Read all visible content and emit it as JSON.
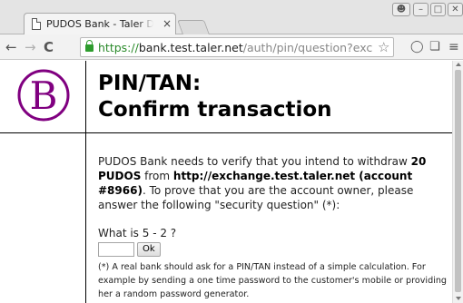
{
  "browser": {
    "tab_title": "PUDOS Bank - Taler Demo",
    "tab_close": "×",
    "url_scheme": "https://",
    "url_host": "bank.test.taler.net",
    "url_path": "/auth/pin/question?exchange_url=https://exchange.test.taler.net/",
    "icons": {
      "back": "back-arrow-icon",
      "forward": "forward-arrow-icon",
      "reload": "reload-icon",
      "lock": "lock-icon",
      "star": "star-icon",
      "menu": "hamburger-menu-icon"
    }
  },
  "page": {
    "heading_line1": "PIN/TAN:",
    "heading_line2": "Confirm transaction",
    "logo_letter": "B",
    "logo_color": "#800080",
    "intro": {
      "part1": "PUDOS Bank needs to verify that you intend to withdraw ",
      "amount": "20 PUDOS",
      "part2": " from ",
      "exchange": "http://exchange.test.taler.net (account #8966)",
      "part3": ". To prove that you are the account owner, please answer the following \"security question\" (*):"
    },
    "question": "What is 5 - 2 ?",
    "answer_value": "",
    "ok_label": "Ok",
    "footnote": "(*) A real bank should ask for a PIN/TAN instead of a simple calculation. For example by sending a one time password to the customer's mobile or providing her a random password generator."
  }
}
